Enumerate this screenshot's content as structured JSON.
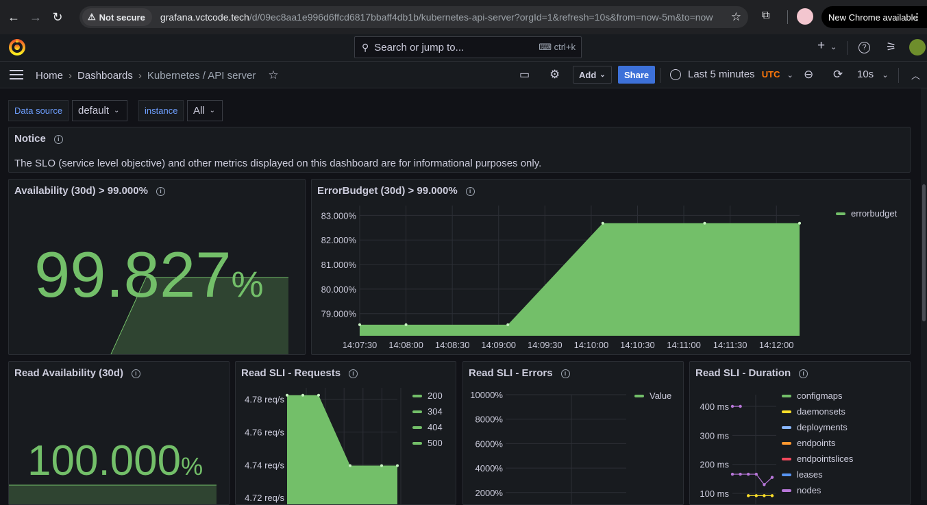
{
  "browser": {
    "security_label": "Not secure",
    "url_host": "grafana.vctcode.tech",
    "url_path": "/d/09ec8aa1e996d6ffcd6817bbaff4db1b/kubernetes-api-server?orgId=1&refresh=10s&from=now-5m&to=now",
    "update_label": "New Chrome available"
  },
  "topbar": {
    "search_placeholder": "Search or jump to...",
    "search_shortcut": "ctrl+k"
  },
  "breadcrumb": {
    "home": "Home",
    "dashboards": "Dashboards",
    "current": "Kubernetes / API server"
  },
  "toolbar": {
    "add_label": "Add",
    "share_label": "Share",
    "time_range": "Last 5 minutes",
    "timezone": "UTC",
    "refresh_interval": "10s"
  },
  "variables": [
    {
      "label": "Data source",
      "value": "default"
    },
    {
      "label": "instance",
      "value": "All"
    }
  ],
  "notice": {
    "title": "Notice",
    "text": "The SLO (service level objective) and other metrics displayed on this dashboard are for informational purposes only."
  },
  "availability": {
    "title": "Availability (30d) > 99.000%",
    "value": "99.827",
    "unit": "%"
  },
  "errorbudget": {
    "title": "ErrorBudget (30d) > 99.000%",
    "legend": "errorbudget"
  },
  "read_availability": {
    "title": "Read Availability (30d)",
    "value": "100.000",
    "unit": "%"
  },
  "read_requests": {
    "title": "Read SLI - Requests",
    "legend": [
      "200",
      "304",
      "404",
      "500"
    ]
  },
  "read_errors": {
    "title": "Read SLI - Errors",
    "legend": [
      "Value"
    ]
  },
  "read_duration": {
    "title": "Read SLI - Duration",
    "legend": [
      "configmaps",
      "daemonsets",
      "deployments",
      "endpoints",
      "endpointslices",
      "leases",
      "nodes"
    ]
  },
  "colors": {
    "green": "#73bf69",
    "yellow": "#fade2a",
    "blue": "#8ab8ff",
    "orange": "#ff9830",
    "red": "#f2495c",
    "lightblue": "#5794f2",
    "purple": "#b877d9"
  },
  "chart_data": [
    {
      "type": "area",
      "title": "ErrorBudget (30d) > 99.000%",
      "x": [
        "14:07:30",
        "14:08:00",
        "14:08:30",
        "14:09:00",
        "14:09:30",
        "14:10:00",
        "14:10:30",
        "14:11:00",
        "14:11:30",
        "14:12:00"
      ],
      "yticks": [
        "79.000%",
        "80.000%",
        "81.000%",
        "82.000%",
        "83.000%"
      ],
      "ylim": [
        78.1,
        83.4
      ],
      "series": [
        {
          "name": "errorbudget",
          "points": [
            [
              0,
              78.55
            ],
            [
              1,
              78.55
            ],
            [
              3.2,
              78.55
            ],
            [
              5.25,
              82.68
            ],
            [
              7.45,
              82.68
            ],
            [
              9.5,
              82.68
            ]
          ]
        }
      ]
    },
    {
      "type": "area",
      "title": "Read SLI - Requests",
      "yticks": [
        "4.72 req/s",
        "4.74 req/s",
        "4.76 req/s",
        "4.78 req/s"
      ],
      "ylim": [
        4.715,
        4.787
      ],
      "series": [
        {
          "name": "200",
          "points": [
            [
              0,
              4.7825
            ],
            [
              1,
              4.7825
            ],
            [
              2,
              4.7825
            ],
            [
              4,
              4.7395
            ],
            [
              6,
              4.7395
            ],
            [
              7,
              4.7395
            ]
          ]
        }
      ]
    },
    {
      "type": "line",
      "title": "Read SLI - Errors",
      "yticks": [
        "2000%",
        "4000%",
        "6000%",
        "8000%",
        "10000%"
      ],
      "series": [
        {
          "name": "Value",
          "values": []
        }
      ]
    },
    {
      "type": "line",
      "title": "Read SLI - Duration",
      "yticks": [
        "100 ms",
        "200 ms",
        "300 ms",
        "400 ms"
      ],
      "series": [
        {
          "name": "nodes",
          "points": [
            [
              0,
              400
            ],
            [
              1,
              400
            ]
          ]
        },
        {
          "name": "leases",
          "points": [
            [
              0,
              166
            ],
            [
              1,
              166
            ],
            [
              2,
              166
            ],
            [
              3,
              166
            ],
            [
              4,
              130
            ],
            [
              5,
              155
            ]
          ]
        },
        {
          "name": "daemonsets",
          "points": [
            [
              2,
              92
            ],
            [
              3,
              92
            ],
            [
              4,
              92
            ],
            [
              5,
              92
            ]
          ]
        }
      ]
    }
  ]
}
